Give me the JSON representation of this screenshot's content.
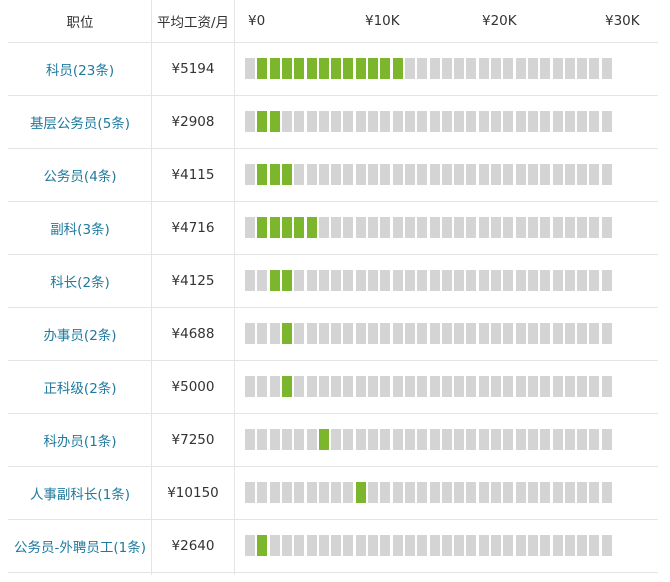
{
  "header": {
    "title_col": "职位",
    "salary_col": "平均工资/月",
    "ticks": [
      "¥0",
      "¥10K",
      "¥20K",
      "¥30K"
    ]
  },
  "chart_data": {
    "type": "bar",
    "xlabel": "",
    "ylabel": "",
    "xlim": [
      0,
      30000
    ],
    "cells_total": 30,
    "categories": [
      "科员(23条)",
      "基层公务员(5条)",
      "公务员(4条)",
      "副科(3条)",
      "科长(2条)",
      "办事员(2条)",
      "正科级(2条)",
      "科办员(1条)",
      "人事副科长(1条)",
      "公务员-外聘员工(1条)"
    ],
    "values": [
      5194,
      2908,
      4115,
      4716,
      4125,
      4688,
      5000,
      7250,
      10150,
      2640
    ],
    "salary_labels": [
      "¥5194",
      "¥2908",
      "¥4115",
      "¥4716",
      "¥4125",
      "¥4688",
      "¥5000",
      "¥7250",
      "¥10150",
      "¥2640"
    ],
    "highlighted_cells": [
      [
        2,
        13
      ],
      [
        2,
        3
      ],
      [
        2,
        4
      ],
      [
        2,
        6
      ],
      [
        3,
        4
      ],
      [
        4,
        4
      ],
      [
        4,
        4
      ],
      [
        7,
        7
      ],
      [
        10,
        10
      ],
      [
        2,
        2
      ]
    ],
    "colors": {
      "filled": "#7cb62d",
      "empty": "#d4d4d4",
      "link": "#1f7a9e"
    }
  }
}
